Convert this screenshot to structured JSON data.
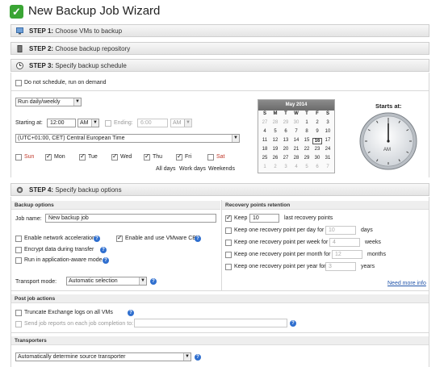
{
  "window": {
    "title": "New Backup Job Wizard"
  },
  "steps": [
    {
      "num": "STEP 1:",
      "label": "Choose VMs to backup"
    },
    {
      "num": "STEP 2:",
      "label": "Choose backup repository"
    },
    {
      "num": "STEP 3:",
      "label": "Specify backup schedule"
    },
    {
      "num": "STEP 4:",
      "label": "Specify backup options"
    }
  ],
  "schedule": {
    "no_schedule_label": "Do not schedule, run on demand",
    "frequency": "Run daily/weekly",
    "starting_at_label": "Starting at:",
    "start_time": "12:00",
    "start_ampm": "AM",
    "ending_label": "Ending:",
    "end_time": "6:00",
    "end_ampm": "AM",
    "timezone": "(UTC+01:00, CET) Central European Time",
    "days": [
      {
        "label": "Sun",
        "checked": false,
        "weekend": true
      },
      {
        "label": "Mon",
        "checked": true,
        "weekend": false
      },
      {
        "label": "Tue",
        "checked": true,
        "weekend": false
      },
      {
        "label": "Wed",
        "checked": true,
        "weekend": false
      },
      {
        "label": "Thu",
        "checked": true,
        "weekend": false
      },
      {
        "label": "Fri",
        "checked": true,
        "weekend": false
      },
      {
        "label": "Sat",
        "checked": false,
        "weekend": true
      }
    ],
    "day_presets": [
      "All days",
      "Work days",
      "Weekends"
    ]
  },
  "calendar": {
    "month": "May 2014",
    "weekday_headers": [
      "S",
      "M",
      "T",
      "W",
      "T",
      "F",
      "S"
    ],
    "rows": [
      [
        "27",
        "28",
        "29",
        "30",
        "1",
        "2",
        "3"
      ],
      [
        "4",
        "5",
        "6",
        "7",
        "8",
        "9",
        "10"
      ],
      [
        "11",
        "12",
        "13",
        "14",
        "15",
        "16",
        "17"
      ],
      [
        "18",
        "19",
        "20",
        "21",
        "22",
        "23",
        "24"
      ],
      [
        "25",
        "26",
        "27",
        "28",
        "29",
        "30",
        "31"
      ],
      [
        "1",
        "2",
        "3",
        "4",
        "5",
        "6",
        "7"
      ]
    ],
    "selected": "16"
  },
  "clock": {
    "label": "Starts at:",
    "ampm": "AM"
  },
  "backup_options": {
    "header": "Backup options",
    "job_name_label": "Job name:",
    "job_name": "New backup job",
    "network_accel": "Enable network acceleration",
    "encrypt": "Encrypt data during transfer",
    "app_aware": "Run in application-aware mode",
    "cbt": "Enable and use VMware CBT",
    "transport_label": "Transport mode:",
    "transport_value": "Automatic selection"
  },
  "retention": {
    "header": "Recovery points retention",
    "keep_label": "Keep",
    "keep_value": "10",
    "keep_suffix": "last recovery points",
    "rows": [
      {
        "label": "Keep one recovery point per day for",
        "value": "10",
        "unit": "days"
      },
      {
        "label": "Keep one recovery point per week for",
        "value": "4",
        "unit": "weeks"
      },
      {
        "label": "Keep one recovery point per month for",
        "value": "12",
        "unit": "months"
      },
      {
        "label": "Keep one recovery point per year for",
        "value": "3",
        "unit": "years"
      }
    ],
    "more_info": "Need more info"
  },
  "post_job": {
    "header": "Post job actions",
    "truncate": "Truncate Exchange logs on all VMs",
    "send_reports": "Send job reports on each job completion to:"
  },
  "transporters": {
    "header": "Transporters",
    "value": "Automatically determine source transporter"
  }
}
